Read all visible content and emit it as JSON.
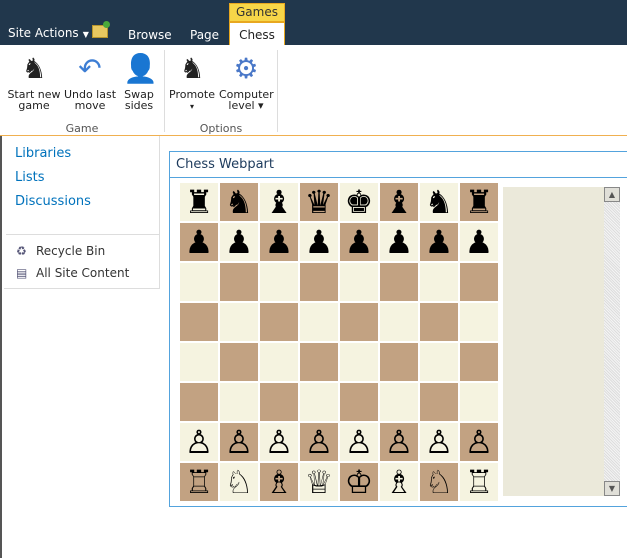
{
  "topbar": {
    "site_actions": "Site Actions",
    "tabs": [
      "Browse",
      "Page"
    ],
    "context_group": "Games",
    "active_tab": "Chess"
  },
  "ribbon": {
    "buttons": [
      {
        "label1": "Start new",
        "label2": "game"
      },
      {
        "label1": "Undo last",
        "label2": "move"
      },
      {
        "label1": "Swap",
        "label2": "sides"
      },
      {
        "label1": "Promote",
        "label2": "▾"
      },
      {
        "label1": "Computer",
        "label2": "level ▾"
      }
    ],
    "groups": [
      "Game",
      "Options"
    ]
  },
  "nav": {
    "links": [
      "Libraries",
      "Lists",
      "Discussions"
    ],
    "recycle_bin": "Recycle Bin",
    "all_site_content": "All Site Content"
  },
  "webpart": {
    "title": "Chess Webpart",
    "board": [
      "♜♞♝♛♚♝♞♜",
      "♟♟♟♟♟♟♟♟",
      "        ",
      "        ",
      "        ",
      "        ",
      "♙♙♙♙♙♙♙♙",
      "♖♘♗♕♔♗♘♖"
    ],
    "light_color": "#f5f3e0",
    "dark_color": "#c2a282",
    "move_list": ""
  }
}
